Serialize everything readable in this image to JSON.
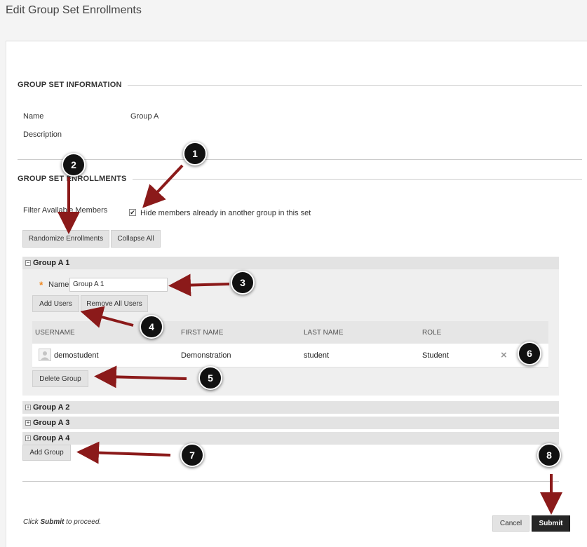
{
  "page_title": "Edit Group Set Enrollments",
  "group_set_information": {
    "heading": "GROUP SET INFORMATION",
    "name_label": "Name",
    "name_value": "Group A",
    "description_label": "Description"
  },
  "group_set_enrollments": {
    "heading": "GROUP SET ENROLLMENTS",
    "filter_label": "Filter Available Members",
    "hide_checkbox_label": "Hide members already in another group in this set",
    "hide_checked": true,
    "randomize_button": "Randomize Enrollments",
    "collapse_button": "Collapse All"
  },
  "groups": [
    {
      "title": "Group A 1",
      "expanded": true
    },
    {
      "title": "Group A 2",
      "expanded": false
    },
    {
      "title": "Group A 3",
      "expanded": false
    },
    {
      "title": "Group A 4",
      "expanded": false
    }
  ],
  "group_editor": {
    "required_mark": "*",
    "name_label": "Name",
    "name_value": "Group A 1",
    "add_users_button": "Add Users",
    "remove_all_button": "Remove All Users",
    "delete_group_button": "Delete Group"
  },
  "table": {
    "columns": [
      "USERNAME",
      "FIRST NAME",
      "LAST NAME",
      "ROLE"
    ],
    "rows": [
      {
        "username": "demostudent",
        "first_name": "Demonstration",
        "last_name": "student",
        "role": "Student",
        "remove_icon": "×"
      }
    ]
  },
  "add_group_button": "Add Group",
  "footer": {
    "hint_prefix": "Click ",
    "hint_bold": "Submit",
    "hint_suffix": " to proceed.",
    "cancel_button": "Cancel",
    "submit_button": "Submit"
  },
  "callouts": [
    "1",
    "2",
    "3",
    "4",
    "5",
    "6",
    "7",
    "8"
  ],
  "colors": {
    "arrow": "#8b1a1a",
    "callout_bg": "#111111",
    "required": "#f08a24",
    "submit_bg": "#262626"
  }
}
